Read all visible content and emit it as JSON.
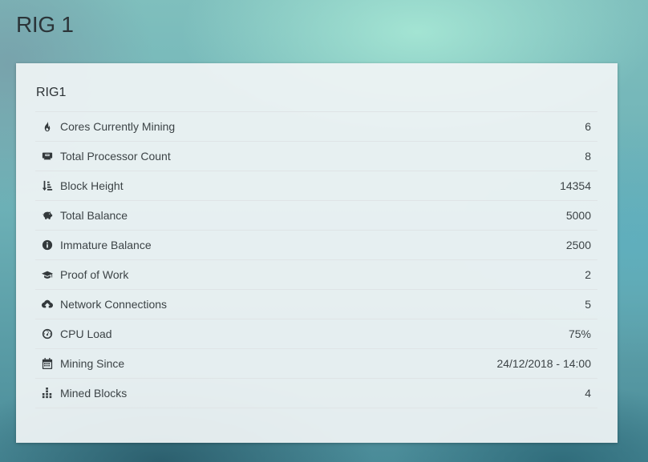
{
  "page": {
    "title": "RIG 1"
  },
  "card": {
    "title": "RIG1",
    "rows": [
      {
        "icon": "fire-icon",
        "label": "Cores Currently Mining",
        "value": "6"
      },
      {
        "icon": "processor-icon",
        "label": "Total Processor Count",
        "value": "8"
      },
      {
        "icon": "sort-amount-icon",
        "label": "Block Height",
        "value": "14354"
      },
      {
        "icon": "piggy-bank-icon",
        "label": "Total Balance",
        "value": "5000"
      },
      {
        "icon": "info-circle-icon",
        "label": "Immature Balance",
        "value": "2500"
      },
      {
        "icon": "graduation-cap-icon",
        "label": "Proof of Work",
        "value": "2"
      },
      {
        "icon": "cloud-upload-icon",
        "label": "Network Connections",
        "value": "5"
      },
      {
        "icon": "dashboard-gauge-icon",
        "label": "CPU Load",
        "value": "75%"
      },
      {
        "icon": "calendar-icon",
        "label": "Mining Since",
        "value": "24/12/2018 - 14:00"
      },
      {
        "icon": "bar-blocks-icon",
        "label": "Mined Blocks",
        "value": "4"
      }
    ]
  }
}
